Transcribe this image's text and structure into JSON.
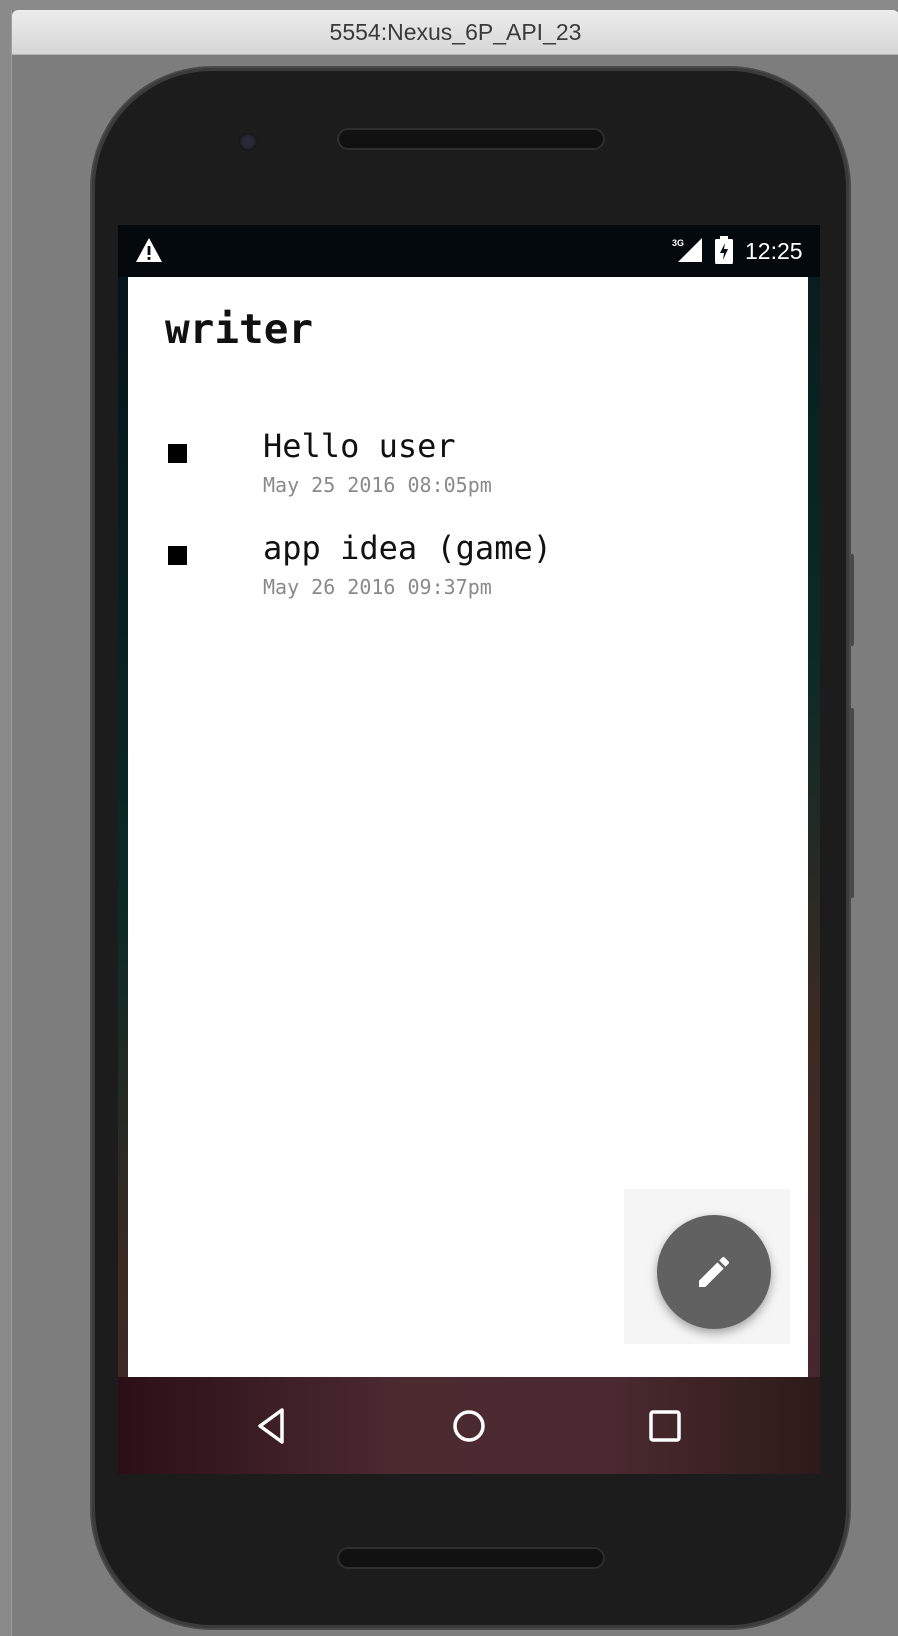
{
  "window": {
    "title": "5554:Nexus_6P_API_23"
  },
  "statusbar": {
    "time": "12:25",
    "network_label": "3G",
    "icons": [
      "warning-icon",
      "signal-icon",
      "battery-icon"
    ]
  },
  "app": {
    "title": "writer",
    "notes": [
      {
        "title": "Hello user",
        "date": "May 25 2016 08:05pm"
      },
      {
        "title": "app idea (game)",
        "date": "May 26 2016 09:37pm"
      }
    ],
    "fab": {
      "icon": "pencil-icon"
    }
  },
  "navbar": {
    "buttons": [
      "back-icon",
      "home-icon",
      "recents-icon"
    ]
  },
  "colors": {
    "app_background": "#ffffff",
    "fab": "#616161",
    "note_date": "#8a8a8a",
    "statusbar": "#03090d"
  }
}
